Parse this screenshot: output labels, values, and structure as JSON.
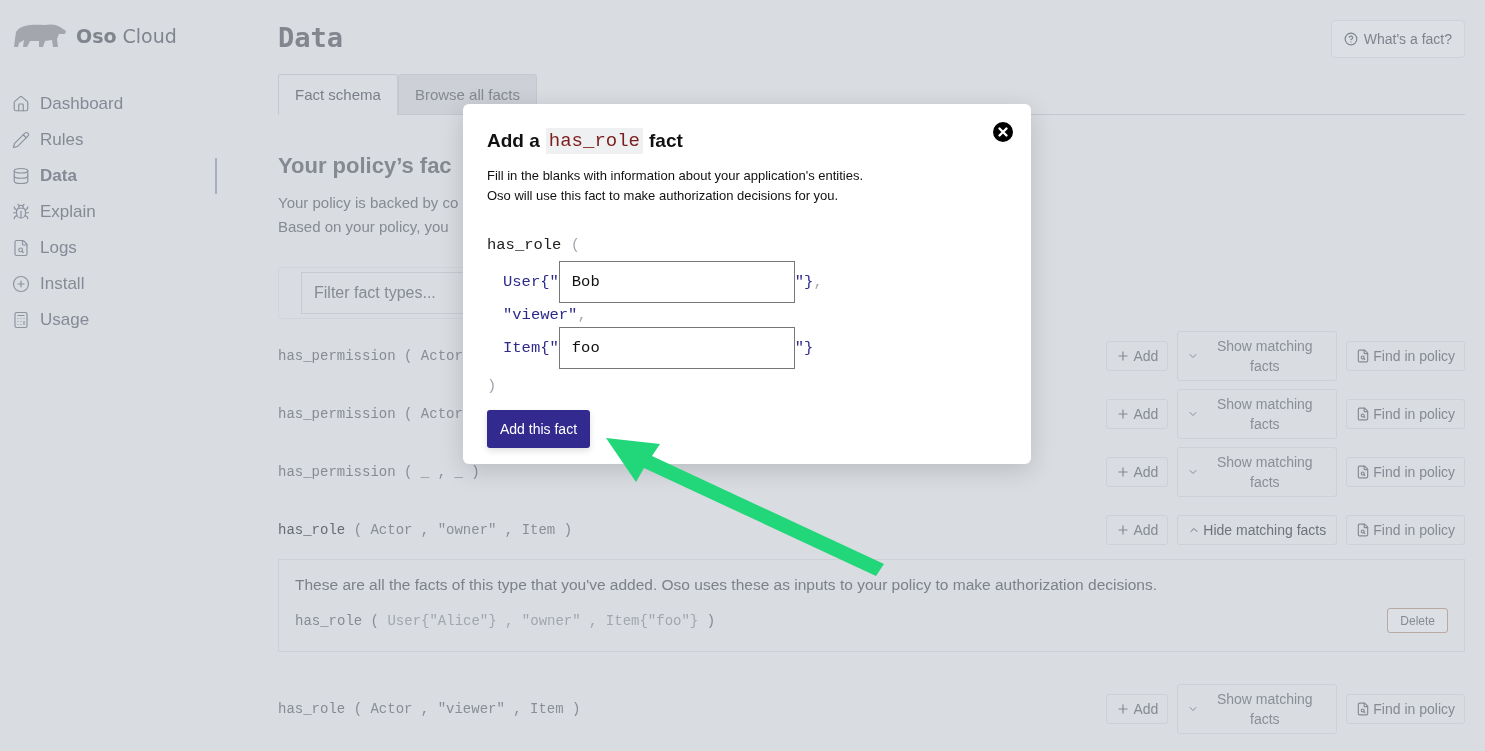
{
  "sidebar": {
    "logo": "**Oso** Cloud",
    "items": [
      {
        "label": "Dashboard",
        "selected": false
      },
      {
        "label": "Rules",
        "selected": false
      },
      {
        "label": "Data",
        "selected": true
      },
      {
        "label": "Explain",
        "selected": false
      },
      {
        "label": "Logs",
        "selected": false
      },
      {
        "label": "Install",
        "selected": false
      },
      {
        "label": "Usage",
        "selected": false
      }
    ]
  },
  "page": {
    "title": "Data",
    "help_button": "What's a fact?",
    "tabs": [
      {
        "label": "Fact schema",
        "selected": true
      },
      {
        "label": "Browse all facts",
        "selected": false
      }
    ],
    "heading": "Your policy’s fac",
    "intro": [
      "Your policy is backed by co",
      "Based on your policy, you"
    ],
    "filter": {
      "placeholder": "Filter fact types..."
    },
    "rows": [
      {
        "name": "has_permission",
        "args": "( Actor",
        "add": "Add",
        "toggle": "Show matching facts",
        "expanded": false,
        "find": "Find in policy"
      },
      {
        "name": "has_permission",
        "args": "( Actor",
        "add": "Add",
        "toggle": "Show matching facts",
        "expanded": false,
        "find": "Find in policy"
      },
      {
        "name": "has_permission",
        "args": "( _ , _ )",
        "add": "Add",
        "toggle": "Show matching facts",
        "expanded": false,
        "find": "Find in policy"
      },
      {
        "name": "has_role",
        "args": "( Actor , \"owner\" , Item )",
        "add": "Add",
        "toggle": "Hide matching facts",
        "expanded": true,
        "find": "Find in policy",
        "panel": {
          "text": "These are all the facts of this type that you've added. Oso uses these as inputs to your policy to make authorization decisions.",
          "facts": [
            {
              "name": "has_role ( ",
              "args": "User{\"Alice\"} , \"owner\" , Item{\"foo\"}",
              "close": " )",
              "delete": "Delete"
            }
          ]
        }
      },
      {
        "name": "has_role",
        "args": "( Actor , \"viewer\" , Item )",
        "add": "Add",
        "toggle": "Show matching facts",
        "expanded": false,
        "find": "Find in policy"
      }
    ]
  },
  "modal": {
    "title_before": "Add a",
    "title_code": "has_role",
    "title_after": "fact",
    "description": [
      "Fill in the blanks with information about your application's entities.",
      "Oso will use this fact to make authorization decisions for you."
    ],
    "function": "has_role",
    "open": "(",
    "close": ")",
    "fields": [
      {
        "kind": "input",
        "prefix": "User{\"",
        "value": "Bob",
        "suffix": "\"}",
        "separator": ","
      },
      {
        "kind": "literal",
        "text": "\"viewer\"",
        "separator": ","
      },
      {
        "kind": "input",
        "prefix": "Item{\"",
        "value": "foo",
        "suffix": "\"}"
      }
    ],
    "submit": "Add this fact"
  }
}
